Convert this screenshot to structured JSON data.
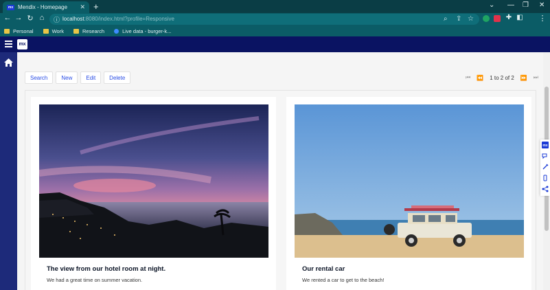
{
  "browser": {
    "tab_title": "Mendix - Homepage",
    "tab_favicon": "mx",
    "url_host": "localhost",
    "url_rest": ":8080/index.html?profile=Responsive",
    "bookmarks": [
      {
        "label": "Personal",
        "icon": "folder-icon"
      },
      {
        "label": "Work",
        "icon": "folder-icon"
      },
      {
        "label": "Research",
        "icon": "folder-icon"
      },
      {
        "label": "Live data - burger-k...",
        "icon": "live-data-icon"
      }
    ]
  },
  "app": {
    "logo": "mx",
    "buttons": {
      "search": "Search",
      "new": "New",
      "edit": "Edit",
      "delete": "Delete"
    },
    "pager": {
      "label": "1 to 2 of 2"
    },
    "cards": [
      {
        "title": "The view from our hotel room at night.",
        "description": "We had a great time on summer vacation."
      },
      {
        "title": "Our rental car",
        "description": "We rented a car to get to the beach!"
      }
    ]
  },
  "colors": {
    "browser_frame": "#0b5c66",
    "mendix_navy": "#0a1362",
    "sidebar": "#1d2a7a",
    "link_blue": "#264ae5"
  }
}
